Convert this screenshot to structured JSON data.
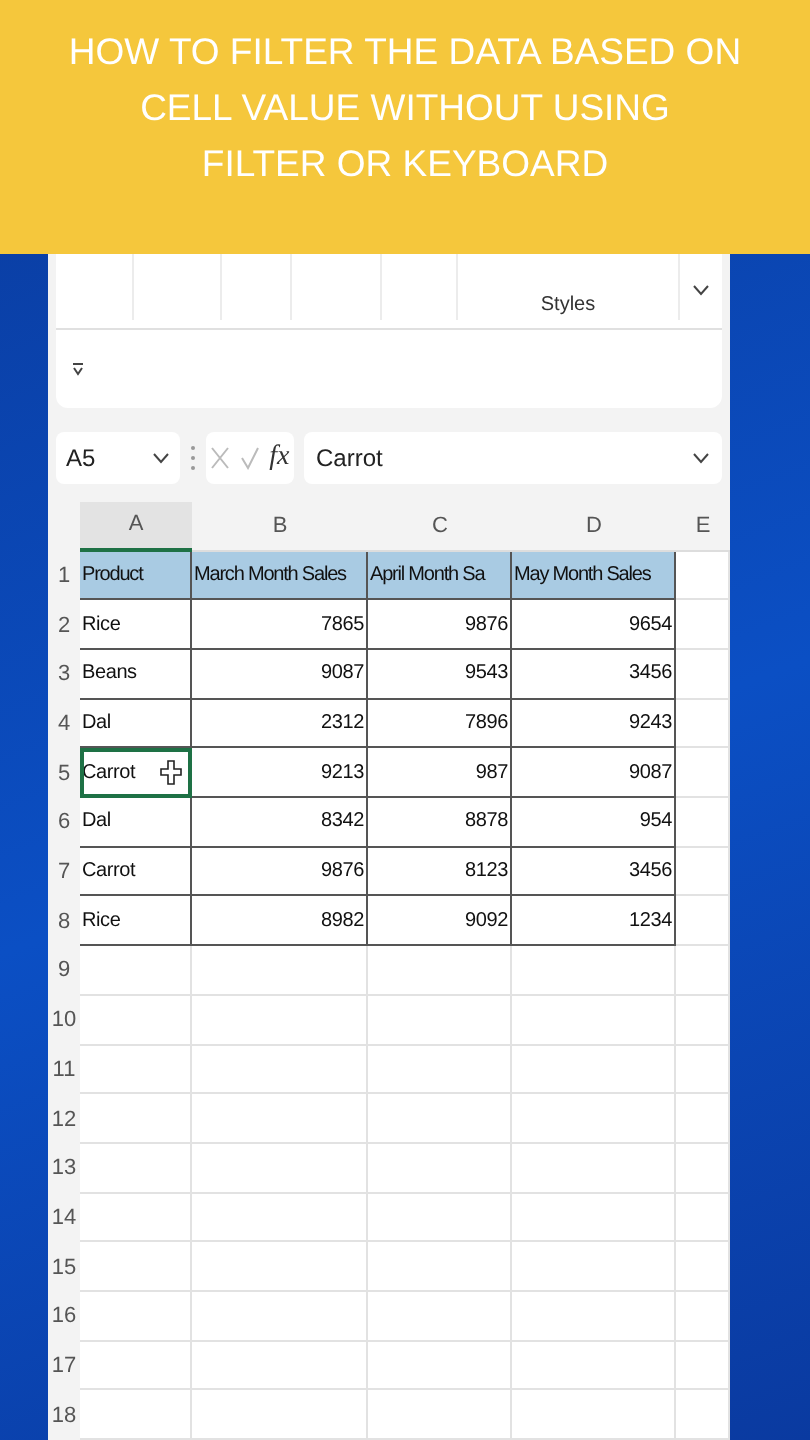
{
  "banner": {
    "title_lines": [
      "HOW TO FILTER THE DATA BASED ON",
      "CELL VALUE WITHOUT USING",
      "FILTER OR KEYBOARD"
    ]
  },
  "ribbon": {
    "group_label": "Styles"
  },
  "formula_bar": {
    "name_box": "A5",
    "function_label": "fx",
    "value": "Carrot"
  },
  "sheet": {
    "column_letters": [
      "A",
      "B",
      "C",
      "D",
      "E"
    ],
    "row_numbers": [
      "1",
      "2",
      "3",
      "4",
      "5",
      "6",
      "7",
      "8",
      "9",
      "10",
      "11",
      "12",
      "13",
      "14",
      "15",
      "16",
      "17",
      "18"
    ],
    "rows": [
      {
        "kind": "header",
        "selected": false,
        "cells": [
          "Product",
          "March Month Sales",
          "April Month Sa",
          "May Month Sales"
        ]
      },
      {
        "kind": "data",
        "selected": false,
        "cells": [
          "Rice",
          "7865",
          "9876",
          "9654"
        ]
      },
      {
        "kind": "data",
        "selected": false,
        "cells": [
          "Beans",
          "9087",
          "9543",
          "3456"
        ]
      },
      {
        "kind": "data",
        "selected": false,
        "cells": [
          "Dal",
          "2312",
          "7896",
          "9243"
        ]
      },
      {
        "kind": "data",
        "selected": true,
        "cells": [
          "Carrot",
          "9213",
          "987",
          "9087"
        ]
      },
      {
        "kind": "data",
        "selected": false,
        "cells": [
          "Dal",
          "8342",
          "8878",
          "954"
        ]
      },
      {
        "kind": "data",
        "selected": false,
        "cells": [
          "Carrot",
          "9876",
          "8123",
          "3456"
        ]
      },
      {
        "kind": "data",
        "selected": false,
        "cells": [
          "Rice",
          "8982",
          "9092",
          "1234"
        ]
      }
    ]
  }
}
